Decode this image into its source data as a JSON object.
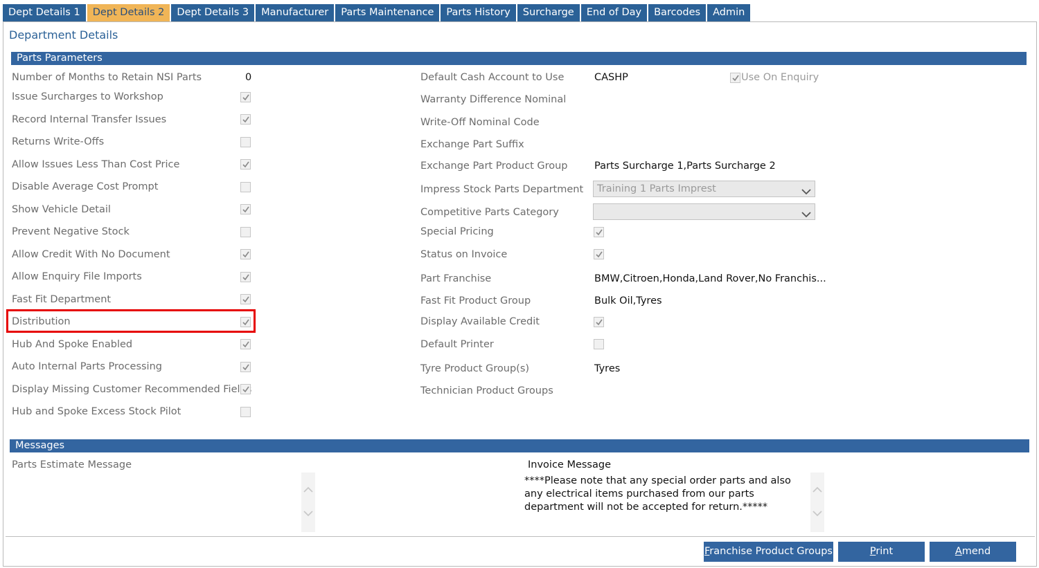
{
  "tabs": [
    {
      "label": "Dept Details 1",
      "active": false
    },
    {
      "label": "Dept Details 2",
      "active": true
    },
    {
      "label": "Dept Details 3",
      "active": false
    },
    {
      "label": "Manufacturer",
      "active": false
    },
    {
      "label": "Parts Maintenance",
      "active": false
    },
    {
      "label": "Parts History",
      "active": false
    },
    {
      "label": "Surcharge",
      "active": false
    },
    {
      "label": "End of Day",
      "active": false
    },
    {
      "label": "Barcodes",
      "active": false
    },
    {
      "label": "Admin",
      "active": false
    }
  ],
  "page_title": "Department Details",
  "parts_parameters": {
    "header": "Parts Parameters",
    "left": [
      {
        "label": "Number of Months to Retain NSI Parts",
        "type": "text",
        "value": "0"
      },
      {
        "label": "Issue Surcharges to Workshop",
        "type": "checkbox",
        "checked": true
      },
      {
        "label": "Record Internal Transfer Issues",
        "type": "checkbox",
        "checked": true
      },
      {
        "label": "Returns Write-Offs",
        "type": "checkbox",
        "checked": false
      },
      {
        "label": "Allow Issues Less Than Cost Price",
        "type": "checkbox",
        "checked": true
      },
      {
        "label": "Disable Average Cost Prompt",
        "type": "checkbox",
        "checked": false
      },
      {
        "label": "Show Vehicle Detail",
        "type": "checkbox",
        "checked": true
      },
      {
        "label": "Prevent Negative Stock",
        "type": "checkbox",
        "checked": false
      },
      {
        "label": "Allow Credit With No Document",
        "type": "checkbox",
        "checked": true
      },
      {
        "label": "Allow Enquiry File Imports",
        "type": "checkbox",
        "checked": true
      },
      {
        "label": "Fast Fit Department",
        "type": "checkbox",
        "checked": true
      },
      {
        "label": "Distribution",
        "type": "checkbox",
        "checked": true
      },
      {
        "label": "Hub And Spoke Enabled",
        "type": "checkbox",
        "checked": true
      },
      {
        "label": "Auto Internal Parts Processing",
        "type": "checkbox",
        "checked": true
      },
      {
        "label": "Display Missing Customer Recommended Fields",
        "type": "checkbox",
        "checked": true
      },
      {
        "label": "Hub and Spoke Excess Stock Pilot",
        "type": "checkbox",
        "checked": false
      }
    ],
    "right": [
      {
        "label": "Default Cash Account to Use",
        "type": "text",
        "value": "CASHP"
      },
      {
        "label": "Warranty Difference Nominal",
        "type": "text",
        "value": ""
      },
      {
        "label": "Write-Off Nominal Code",
        "type": "text",
        "value": ""
      },
      {
        "label": "Exchange Part Suffix",
        "type": "text",
        "value": ""
      },
      {
        "label": "Exchange Part Product Group",
        "type": "text",
        "value": "Parts Surcharge 1,Parts Surcharge 2"
      },
      {
        "label": "Impress Stock Parts Department",
        "type": "select",
        "value": "Training 1 Parts Imprest"
      },
      {
        "label": "Competitive Parts Category",
        "type": "select",
        "value": ""
      },
      {
        "label": "Special Pricing",
        "type": "checkbox",
        "checked": true
      },
      {
        "label": "Status on Invoice",
        "type": "checkbox",
        "checked": true
      },
      {
        "label": "Part Franchise",
        "type": "text",
        "value": "BMW,Citroen,Honda,Land Rover,No Franchis..."
      },
      {
        "label": "Fast Fit Product Group",
        "type": "text",
        "value": "Bulk Oil,Tyres"
      },
      {
        "label": "Display Available Credit",
        "type": "checkbox",
        "checked": true
      },
      {
        "label": "Default Printer",
        "type": "checkbox",
        "checked": false
      },
      {
        "label": "Tyre Product Group(s)",
        "type": "text",
        "value": "Tyres"
      },
      {
        "label": "Technician Product Groups",
        "type": "text",
        "value": ""
      }
    ],
    "use_on_enquiry": {
      "label": "Use On Enquiry",
      "checked": true
    }
  },
  "messages": {
    "header": "Messages",
    "parts_estimate_label": "Parts Estimate Message",
    "parts_estimate_text": "",
    "invoice_label": "Invoice Message",
    "invoice_text": "****Please note that any special order parts and also any electrical items purchased from our parts department will not be accepted for return.*****"
  },
  "buttons": {
    "franchise_first": "F",
    "franchise_rest": "ranchise Product Groups",
    "print_first": "P",
    "print_rest": "rint",
    "amend_first": "A",
    "amend_rest": "mend"
  },
  "colors": {
    "tab_bg": "#2b6197",
    "tab_active_bg": "#f0b557",
    "section_bar": "#3365a0",
    "button_bg": "#3365a0",
    "highlight_border": "#e60000"
  }
}
